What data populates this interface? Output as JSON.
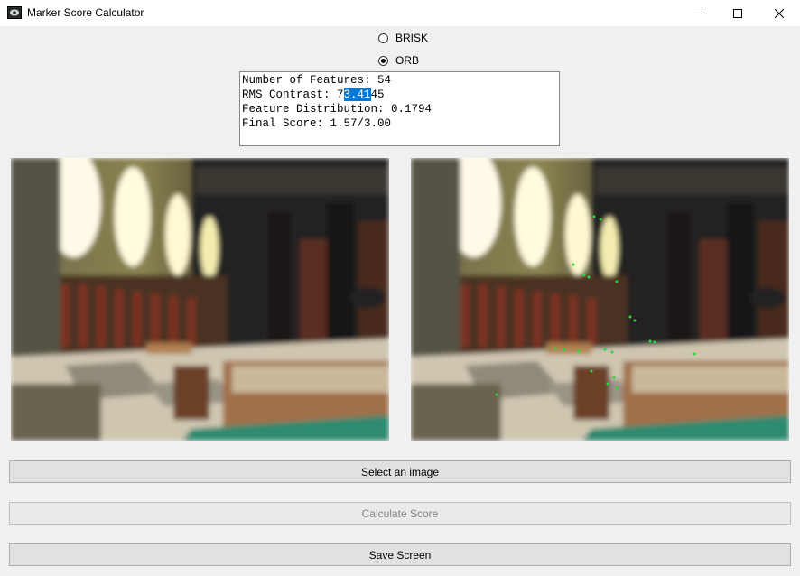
{
  "window": {
    "title": "Marker Score Calculator"
  },
  "detectors": [
    {
      "label": "BRISK",
      "checked": false
    },
    {
      "label": "ORB",
      "checked": true
    }
  ],
  "results": {
    "line1": "Number of Features: 54",
    "line2_pre": "RMS Contrast: 7",
    "line2_sel": "3.41",
    "line2_post": "45",
    "line3": "Feature Distribution: 0.1794",
    "line4": "Final Score: 1.57/3.00"
  },
  "buttons": {
    "select": "Select an image",
    "calculate": "Calculate Score",
    "save": "Save Screen"
  }
}
